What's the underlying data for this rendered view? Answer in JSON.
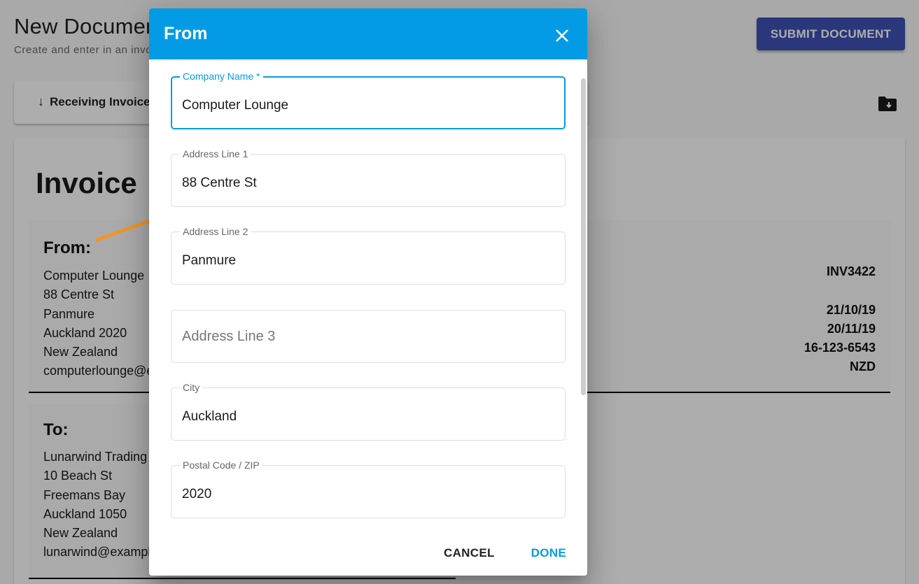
{
  "page": {
    "title": "New Document",
    "subtitle": "Create and enter in an invoice",
    "submit_button": "SUBMIT DOCUMENT",
    "receiving_tab": "Receiving Invoice",
    "icons": {
      "receiving_arrow": "arrow-down-icon",
      "folder": "folder-download-icon"
    }
  },
  "invoice": {
    "title": "Invoice",
    "from": {
      "heading": "From:",
      "lines": [
        "Computer Lounge",
        "88 Centre St",
        "Panmure",
        "Auckland 2020",
        "New Zealand",
        "computerlounge@example.com"
      ]
    },
    "to": {
      "heading": "To:",
      "lines": [
        "Lunarwind Trading",
        "10 Beach St",
        "Freemans Bay",
        "Auckland 1050",
        "New Zealand",
        "lunarwind@example.com"
      ]
    },
    "meta": {
      "invoice_number": "INV3422",
      "invoice_date": "21/10/19",
      "due_date": "20/11/19",
      "gst_number": "16-123-6543",
      "currency": "NZD"
    }
  },
  "dialog": {
    "title": "From",
    "fields": [
      {
        "label": "Company Name *",
        "value": "Computer Lounge",
        "placeholder": "",
        "focused": true
      },
      {
        "label": "Address Line 1",
        "value": "88 Centre St",
        "placeholder": ""
      },
      {
        "label": "Address Line 2",
        "value": "Panmure",
        "placeholder": ""
      },
      {
        "label": "",
        "value": "",
        "placeholder": "Address Line 3"
      },
      {
        "label": "City",
        "value": "Auckland",
        "placeholder": ""
      },
      {
        "label": "Postal Code / ZIP",
        "value": "2020",
        "placeholder": ""
      }
    ],
    "cancel_label": "CANCEL",
    "done_label": "DONE"
  },
  "colors": {
    "accent": "#039be5",
    "primary": "#3f51b5",
    "annotation": "#f7941d"
  }
}
